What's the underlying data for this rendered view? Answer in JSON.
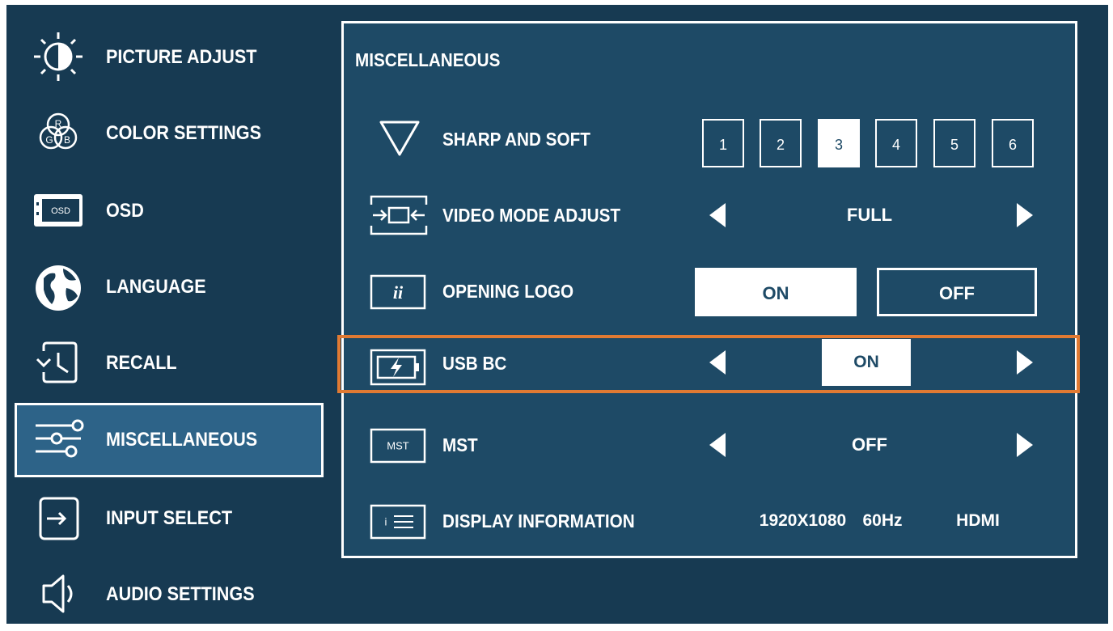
{
  "sidebar": {
    "items": [
      {
        "label": "PICTURE ADJUST",
        "icon": "brightness-icon"
      },
      {
        "label": "COLOR SETTINGS",
        "icon": "rgb-icon"
      },
      {
        "label": "OSD",
        "icon": "osd-icon",
        "icon_text": "OSD"
      },
      {
        "label": "LANGUAGE",
        "icon": "globe-icon"
      },
      {
        "label": "RECALL",
        "icon": "recall-icon"
      },
      {
        "label": "MISCELLANEOUS",
        "icon": "sliders-icon",
        "selected": true
      },
      {
        "label": "INPUT SELECT",
        "icon": "input-icon"
      },
      {
        "label": "AUDIO SETTINGS",
        "icon": "speaker-icon"
      }
    ],
    "rgb_letters": [
      "R",
      "G",
      "B"
    ]
  },
  "panel": {
    "title": "MISCELLANEOUS",
    "rows": {
      "sharp": {
        "label": "SHARP AND SOFT",
        "levels": [
          "1",
          "2",
          "3",
          "4",
          "5",
          "6"
        ],
        "selected_level": "3"
      },
      "video_mode": {
        "label": "VIDEO MODE ADJUST",
        "value": "FULL"
      },
      "opening_logo": {
        "label": "OPENING LOGO",
        "on_label": "ON",
        "off_label": "OFF",
        "selected": "ON"
      },
      "usb_bc": {
        "label": "USB BC",
        "value": "ON"
      },
      "mst": {
        "label": "MST",
        "value": "OFF",
        "icon_text": "MST"
      },
      "display_info": {
        "label": "DISPLAY INFORMATION",
        "resolution": "1920X1080",
        "refresh": "60Hz",
        "input": "HDMI",
        "icon_text": "i"
      }
    }
  },
  "colors": {
    "background": "#173a52",
    "panel": "#1e4a66",
    "selected": "#2d6388",
    "highlight": "#e07a33",
    "text": "#ffffff"
  }
}
